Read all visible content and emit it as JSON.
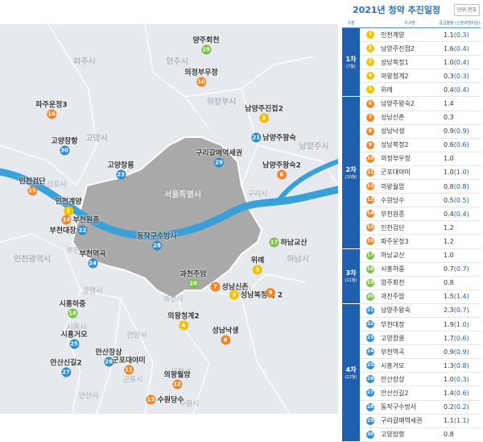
{
  "title": "2021년 청약 추진일정",
  "unit_button": "단위:천호",
  "table_headers": {
    "group": "구분",
    "site": "지구명",
    "value": "공급물량 (신혼희망타운)"
  },
  "seoul_label": "서울특별시",
  "cities": [
    {
      "name": "파주시"
    },
    {
      "name": "양주시"
    },
    {
      "name": "의정부시"
    },
    {
      "name": "고양시"
    },
    {
      "name": "김포시"
    },
    {
      "name": "남양주시"
    },
    {
      "name": "구리시"
    },
    {
      "name": "하남시"
    },
    {
      "name": "인천광역시"
    },
    {
      "name": "부천시"
    },
    {
      "name": "광명시"
    },
    {
      "name": "과천시"
    },
    {
      "name": "성남시"
    },
    {
      "name": "시흥시"
    },
    {
      "name": "안양시"
    },
    {
      "name": "군포시"
    },
    {
      "name": "의왕시"
    },
    {
      "name": "안산시"
    },
    {
      "name": "수원시"
    }
  ],
  "colors": {
    "phase1": "#f2c200",
    "phase2": "#f0862a",
    "phase3": "#7ac143",
    "phase4": "#2f8ecf",
    "header_blue": "#1f5fae"
  },
  "groups": [
    {
      "name": "1차",
      "count": "(7월)",
      "color": "#f2c200",
      "items": [
        {
          "no": "1",
          "name": "인천계양",
          "value": "1.1",
          "sub": "(0.3)"
        },
        {
          "no": "2",
          "name": "남양주진접2",
          "value": "1.6",
          "sub": "(0.4)"
        },
        {
          "no": "3",
          "name": "성남복정1",
          "value": "1.0",
          "sub": "(0.4)"
        },
        {
          "no": "4",
          "name": "의왕청계2",
          "value": "0.3",
          "sub": "(0.3)"
        },
        {
          "no": "5",
          "name": "위례",
          "value": "0.4",
          "sub": "(0.4)"
        }
      ]
    },
    {
      "name": "2차",
      "count": "(10월)",
      "color": "#f0862a",
      "items": [
        {
          "no": "6",
          "name": "남양주왕숙2",
          "value": "1.4",
          "sub": ""
        },
        {
          "no": "7",
          "name": "성남신촌",
          "value": "0.3",
          "sub": ""
        },
        {
          "no": "8",
          "name": "성남낙생",
          "value": "0.9",
          "sub": "(0.9)"
        },
        {
          "no": "9",
          "name": "성남복정2",
          "value": "0.6",
          "sub": "(0.6)"
        },
        {
          "no": "10",
          "name": "의정부우정",
          "value": "1.0",
          "sub": ""
        },
        {
          "no": "11",
          "name": "군포대야미",
          "value": "1.0",
          "sub": "(1.0)"
        },
        {
          "no": "12",
          "name": "의왕월암",
          "value": "0.8",
          "sub": "(0.8)"
        },
        {
          "no": "13",
          "name": "수원당수",
          "value": "0.5",
          "sub": "(0.5)"
        },
        {
          "no": "14",
          "name": "부천원종",
          "value": "0.4",
          "sub": "(0.4)"
        },
        {
          "no": "15",
          "name": "인천검단",
          "value": "1.2",
          "sub": ""
        },
        {
          "no": "16",
          "name": "파주운정3",
          "value": "1.2",
          "sub": ""
        }
      ]
    },
    {
      "name": "3차",
      "count": "(11월)",
      "color": "#7ac143",
      "items": [
        {
          "no": "17",
          "name": "하남교산",
          "value": "1.0",
          "sub": ""
        },
        {
          "no": "18",
          "name": "시흥하중",
          "value": "0.7",
          "sub": "(0.7)"
        },
        {
          "no": "19",
          "name": "양주회천",
          "value": "0.8",
          "sub": ""
        },
        {
          "no": "20",
          "name": "과천주암",
          "value": "1.5",
          "sub": "(1.4)"
        }
      ]
    },
    {
      "name": "4차",
      "count": "(12월)",
      "color": "#2f8ecf",
      "items": [
        {
          "no": "21",
          "name": "남양주왕숙",
          "value": "2.3",
          "sub": "(0.7)"
        },
        {
          "no": "22",
          "name": "부천대장",
          "value": "1.9",
          "sub": "(1.0)"
        },
        {
          "no": "23",
          "name": "고양창릉",
          "value": "1.7",
          "sub": "(0.6)"
        },
        {
          "no": "24",
          "name": "부천역곡",
          "value": "0.9",
          "sub": "(0.9)"
        },
        {
          "no": "25",
          "name": "시흥거모",
          "value": "1.3",
          "sub": "(0.8)"
        },
        {
          "no": "26",
          "name": "안산장상",
          "value": "1.0",
          "sub": "(0.3)"
        },
        {
          "no": "27",
          "name": "안산신길2",
          "value": "1.4",
          "sub": "(0.6)"
        },
        {
          "no": "28",
          "name": "동작구수방사",
          "value": "0.2",
          "sub": "(0.2)"
        },
        {
          "no": "29",
          "name": "구리갈매역세권",
          "value": "1.1",
          "sub": "(1.1)"
        },
        {
          "no": "30",
          "name": "고양장항",
          "value": "0.8",
          "sub": ""
        }
      ]
    }
  ],
  "map_sites": [
    {
      "no": "19",
      "label": "양주회천",
      "phase": 3
    },
    {
      "no": "10",
      "label": "의정부우정",
      "phase": 2
    },
    {
      "no": "16",
      "label": "파주운정3",
      "phase": 2
    },
    {
      "no": "2",
      "label": "남양주진접2",
      "phase": 1
    },
    {
      "no": "21",
      "label": "남양주왕숙",
      "phase": 4
    },
    {
      "no": "30",
      "label": "고양장항",
      "phase": 4
    },
    {
      "no": "23",
      "label": "고양창릉",
      "phase": 4
    },
    {
      "no": "29",
      "label": "구리갈매역세권",
      "phase": 4
    },
    {
      "no": "6",
      "label": "남양주왕숙2",
      "phase": 2
    },
    {
      "no": "15",
      "label": "인천검단",
      "phase": 2
    },
    {
      "no": "1",
      "label": "인천계양",
      "phase": 1
    },
    {
      "no": "14",
      "label": "부천원종",
      "phase": 2
    },
    {
      "no": "22",
      "label": "부천대장",
      "phase": 4
    },
    {
      "no": "28",
      "label": "동작구수방사",
      "phase": 4
    },
    {
      "no": "17",
      "label": "하남교산",
      "phase": 3
    },
    {
      "no": "24",
      "label": "부천역곡",
      "phase": 4
    },
    {
      "no": "5",
      "label": "위례",
      "phase": 1
    },
    {
      "no": "20",
      "label": "과천주암",
      "phase": 3
    },
    {
      "no": "7",
      "label": "성남신촌",
      "phase": 2
    },
    {
      "no": "3",
      "label": "성남복정1, 2",
      "phase": 1
    },
    {
      "no": "9",
      "label": "",
      "phase": 2
    },
    {
      "no": "18",
      "label": "시흥하중",
      "phase": 3
    },
    {
      "no": "4",
      "label": "의왕청계2",
      "phase": 1
    },
    {
      "no": "8",
      "label": "성남낙생",
      "phase": 2
    },
    {
      "no": "25",
      "label": "시흥거모",
      "phase": 4
    },
    {
      "no": "26",
      "label": "안산장상",
      "phase": 4
    },
    {
      "no": "11",
      "label": "군포대야미",
      "phase": 2
    },
    {
      "no": "27",
      "label": "안산신길2",
      "phase": 4
    },
    {
      "no": "12",
      "label": "의왕월암",
      "phase": 2
    },
    {
      "no": "13",
      "label": "수원당수",
      "phase": 2
    }
  ]
}
